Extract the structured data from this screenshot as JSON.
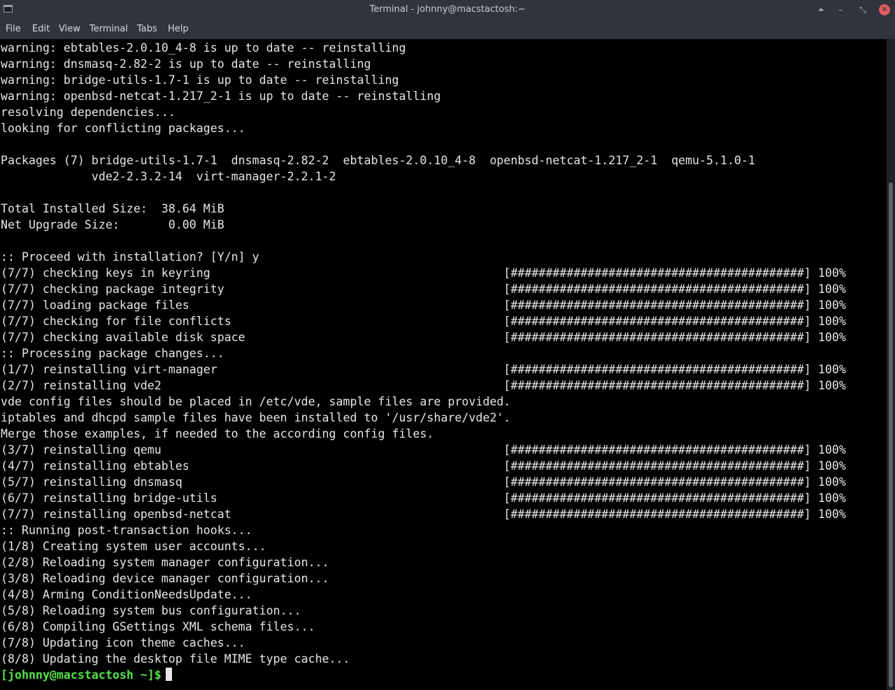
{
  "window": {
    "title": "Terminal - johnny@macstactosh:~",
    "controls": {
      "keep_above": "⏶",
      "minimize": "–",
      "maximize": "⤡",
      "close": "✕"
    }
  },
  "menu": {
    "items": [
      "File",
      "Edit",
      "View",
      "Terminal",
      "Tabs",
      "Help"
    ]
  },
  "terminal": {
    "lines": [
      "warning: ebtables-2.0.10_4-8 is up to date -- reinstalling",
      "warning: dnsmasq-2.82-2 is up to date -- reinstalling",
      "warning: bridge-utils-1.7-1 is up to date -- reinstalling",
      "warning: openbsd-netcat-1.217_2-1 is up to date -- reinstalling",
      "resolving dependencies...",
      "looking for conflicting packages...",
      "",
      "Packages (7) bridge-utils-1.7-1  dnsmasq-2.82-2  ebtables-2.0.10_4-8  openbsd-netcat-1.217_2-1  qemu-5.1.0-1",
      "             vde2-2.3.2-14  virt-manager-2.2.1-2",
      "",
      "Total Installed Size:  38.64 MiB",
      "Net Upgrade Size:       0.00 MiB",
      "",
      ":: Proceed with installation? [Y/n] y",
      "(7/7) checking keys in keyring                                          [##########################################] 100%",
      "(7/7) checking package integrity                                        [##########################################] 100%",
      "(7/7) loading package files                                             [##########################################] 100%",
      "(7/7) checking for file conflicts                                       [##########################################] 100%",
      "(7/7) checking available disk space                                     [##########################################] 100%",
      ":: Processing package changes...",
      "(1/7) reinstalling virt-manager                                         [##########################################] 100%",
      "(2/7) reinstalling vde2                                                 [##########################################] 100%",
      "vde config files should be placed in /etc/vde, sample files are provided.",
      "iptables and dhcpd sample files have been installed to '/usr/share/vde2'.",
      "Merge those examples, if needed to the according config files.",
      "(3/7) reinstalling qemu                                                 [##########################################] 100%",
      "(4/7) reinstalling ebtables                                             [##########################################] 100%",
      "(5/7) reinstalling dnsmasq                                              [##########################################] 100%",
      "(6/7) reinstalling bridge-utils                                         [##########################################] 100%",
      "(7/7) reinstalling openbsd-netcat                                       [##########################################] 100%",
      ":: Running post-transaction hooks...",
      "(1/8) Creating system user accounts...",
      "(2/8) Reloading system manager configuration...",
      "(3/8) Reloading device manager configuration...",
      "(4/8) Arming ConditionNeedsUpdate...",
      "(5/8) Reloading system bus configuration...",
      "(6/8) Compiling GSettings XML schema files...",
      "(7/8) Updating icon theme caches...",
      "(8/8) Updating the desktop file MIME type cache..."
    ],
    "prompt": "[johnny@macstactosh ~]$",
    "prompt_color": "#55e34a",
    "text_color": "#e6e6e6",
    "background": "#000000"
  }
}
